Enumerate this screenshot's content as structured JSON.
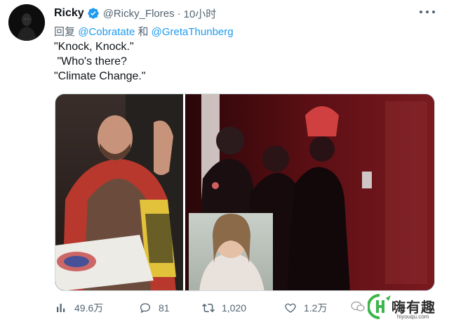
{
  "tweet": {
    "display_name": "Ricky",
    "handle": "@Ricky_Flores",
    "separator": "·",
    "time": "10小时",
    "reply_prefix": "回复",
    "reply_mention_1": "@Cobratate",
    "reply_and": "和",
    "reply_mention_2": "@GretaThunberg",
    "text": "\"Knock, Knock.\"\n \"Who's there?\n\"Climate Change.\"",
    "verified": true
  },
  "actions": {
    "views": "49.6万",
    "replies": "81",
    "retweets": "1,020",
    "likes": "1.2万"
  },
  "watermark": {
    "name": "嗨有趣",
    "url": "hiyouqu.com"
  },
  "icons": {
    "verified": "verified-badge-icon",
    "more": "more-options-icon",
    "views": "analytics-bar-icon",
    "reply": "reply-bubble-icon",
    "retweet": "retweet-icon",
    "like": "heart-icon"
  },
  "colors": {
    "accent": "#1d9bf0",
    "secondary_text": "#536471",
    "primary_text": "#0f1419",
    "watermark_green": "#3cb54a"
  }
}
